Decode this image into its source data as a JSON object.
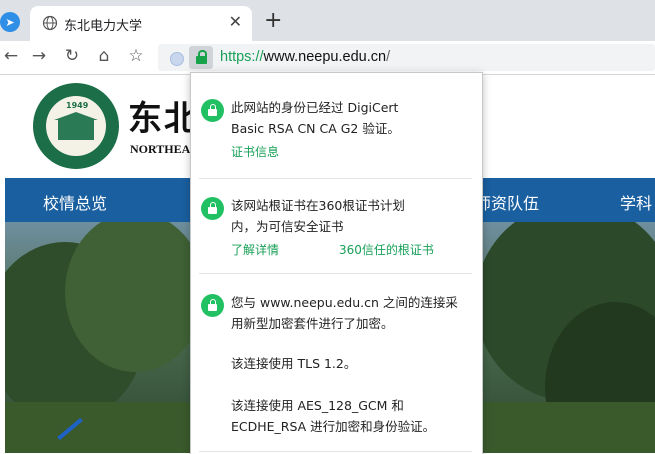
{
  "browser": {
    "tab": {
      "title": "东北电力大学",
      "close_glyph": "✕"
    },
    "new_tab_glyph": "+",
    "toolbar": {
      "back_glyph": "←",
      "forward_glyph": "→",
      "reload_glyph": "↻",
      "home_glyph": "⌂",
      "bookmark_glyph": "☆"
    },
    "address": {
      "scheme": "https://",
      "host": "www.neepu.edu.cn",
      "path": "/"
    }
  },
  "site": {
    "seal_year": "1949",
    "logo_cn": "东北",
    "logo_en": "NORTHEAS",
    "nav": [
      "校情总览",
      "师资队伍",
      "学科"
    ]
  },
  "security_popup": {
    "section1": {
      "lines": [
        "此网站的身份已经过 DigiCert",
        "Basic RSA CN CA G2 验证。"
      ],
      "link": "证书信息"
    },
    "section2": {
      "lines": [
        "该网站根证书在360根证书计划",
        "内，为可信安全证书"
      ],
      "link_learn": "了解详情",
      "link_root": "360信任的根证书"
    },
    "section3": {
      "lines": [
        "您与 www.neepu.edu.cn 之间的连接采",
        "用新型加密套件进行了加密。",
        "该连接使用 TLS 1.2。",
        "该连接使用 AES_128_GCM 和",
        "ECDHE_RSA 进行加密和身份验证。"
      ]
    }
  },
  "colors": {
    "tabstrip": "#dee1e6",
    "secure_green": "#18a058",
    "lock_badge_green": "#21c063",
    "nav_blue": "#1a5fa0",
    "seal_green": "#1b6e47"
  }
}
